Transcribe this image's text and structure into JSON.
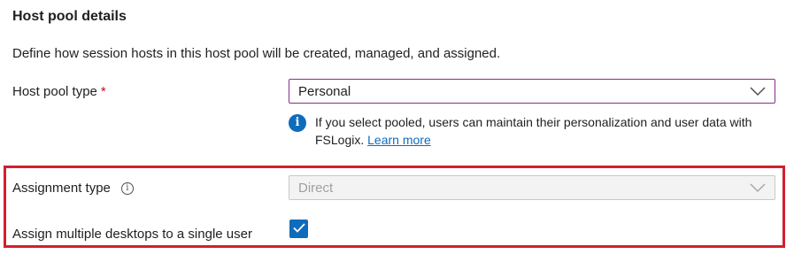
{
  "section": {
    "title": "Host pool details",
    "description": "Define how session hosts in this host pool will be created, managed, and assigned."
  },
  "host_pool_type": {
    "label": "Host pool type",
    "required_marker": "*",
    "value": "Personal",
    "info_text": "If you select pooled, users can maintain their personalization and user data with FSLogix.",
    "info_link": "Learn more"
  },
  "assignment_type": {
    "label": "Assignment type",
    "tooltip_icon": "i",
    "value": "Direct",
    "disabled": true
  },
  "multiple_desktops": {
    "label": "Assign multiple desktops to a single user",
    "checked": true
  },
  "colors": {
    "accent": "#0f6cbd",
    "highlight_border": "#d21f2f",
    "required": "#c50f1f",
    "active_border": "#8a2c8a"
  },
  "icons": {
    "info": "info-filled-icon",
    "chevron": "chevron-down-icon",
    "tooltip": "info-outline-icon",
    "check": "checkmark-icon"
  }
}
